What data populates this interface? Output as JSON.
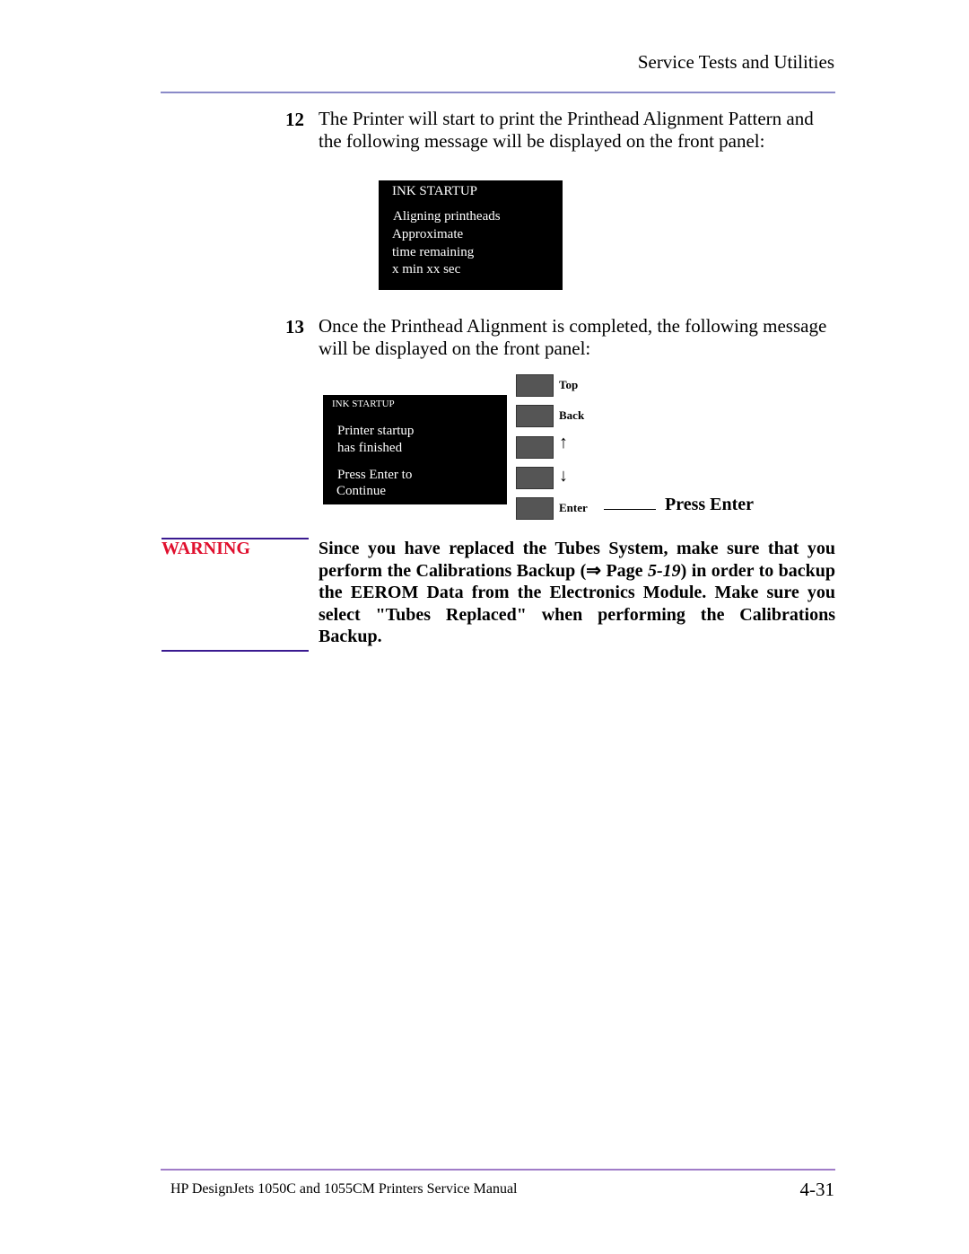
{
  "header": {
    "title": "Service Tests and Utilities"
  },
  "steps": [
    {
      "number": "12",
      "lines": [
        "The Printer will start to print the Printhead Alignment Pattern and",
        "the following message will be displayed on the front panel:"
      ]
    },
    {
      "number": "13",
      "lines": [
        "Once the Printhead Alignment is completed, the following message",
        "will be displayed on the front panel:"
      ]
    }
  ],
  "panel1": {
    "title": "INK STARTUP",
    "lines": [
      "Aligning printheads",
      "Approximate",
      "time remaining",
      "x min xx sec"
    ]
  },
  "panel2": {
    "title": "INK STARTUP",
    "lines": [
      "Printer startup",
      "has finished",
      "Press Enter to",
      "Continue"
    ],
    "keys": [
      {
        "label": "Top",
        "icon": ""
      },
      {
        "label": "Back",
        "icon": ""
      },
      {
        "label": "↑",
        "icon": "arrow-up-icon"
      },
      {
        "label": "↓",
        "icon": "arrow-down-icon"
      },
      {
        "label": "Enter",
        "icon": ""
      }
    ],
    "callout": "Press Enter"
  },
  "warning": {
    "label": "WARNING",
    "text_before": "Since you have replaced the Tubes System, make sure that you perform the Calibrations Backup (⇒ Page ",
    "page_ref": "5-19",
    "text_after": ") in order to backup the EEROM Data from the Electronics Module. Make sure you select \"Tubes Replaced\" when performing the Calibrations Backup.",
    "color": "#e0102e"
  },
  "footer": {
    "manual_title": "HP DesignJets 1050C and 1055CM Printers Service Manual",
    "page_number": "4-31"
  }
}
